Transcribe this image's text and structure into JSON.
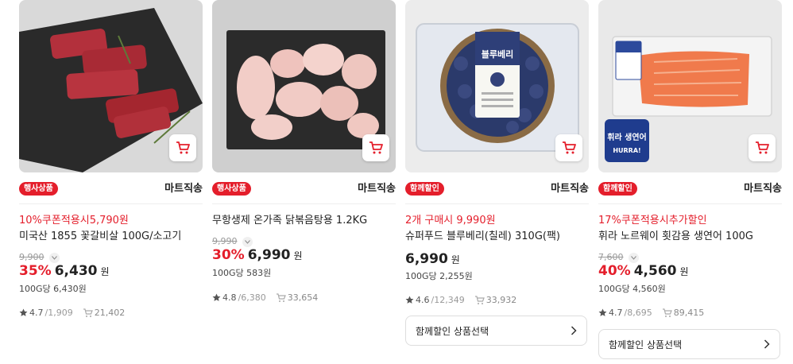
{
  "products": [
    {
      "badge": "행사상품",
      "seller": "마트직송",
      "promo": "10%쿠폰적용시5,790원",
      "name": "미국산 1855 꽃갈비살 100G/소고기",
      "original_price": "9,900",
      "discount": "35%",
      "price": "6,430",
      "won": "원",
      "unit_price": "100G당 6,430원",
      "rating": "4.7",
      "reviews": "/1,909",
      "cart_count": "21,402",
      "image": "beef-ribs-on-slate",
      "colors": {
        "bg": "#d8d8d8",
        "board": "#2a2a2a",
        "meat": "#b3303c"
      }
    },
    {
      "badge": "행사상품",
      "seller": "마트직송",
      "promo": "",
      "name": "무항생제 온가족 닭볶음탕용 1.2KG",
      "original_price": "9,990",
      "discount": "30%",
      "price": "6,990",
      "won": "원",
      "unit_price": "100G당 583원",
      "rating": "4.8",
      "reviews": "/6,380",
      "cart_count": "33,654",
      "image": "chicken-pieces-on-slate",
      "colors": {
        "bg": "#cfcfcf",
        "board": "#2b2b2b",
        "meat": "#f1c9c4"
      }
    },
    {
      "badge": "함께할인",
      "seller": "마트직송",
      "promo": "2개 구매시 9,990원",
      "name": "슈퍼푸드 블루베리(칠레) 310G(팩)",
      "original_price": "",
      "discount": "",
      "price": "6,990",
      "won": "원",
      "unit_price": "100G당 2,255원",
      "rating": "4.6",
      "reviews": "/12,349",
      "cart_count": "33,932",
      "combo_label": "함께할인 상품선택",
      "label_text": "블루베리",
      "image": "blueberry-pack",
      "colors": {
        "bg": "#ececec",
        "berry": "#2b3a6b"
      }
    },
    {
      "badge": "함께할인",
      "seller": "마트직송",
      "promo": "17%쿠폰적용시추가할인",
      "name": "휘라 노르웨이 횟감용 생연어 100G",
      "original_price": "7,600",
      "discount": "40%",
      "price": "4,560",
      "won": "원",
      "unit_price": "100G당 4,560원",
      "rating": "4.7",
      "reviews": "/8,695",
      "cart_count": "89,415",
      "combo_label": "함께할인 상품선택",
      "label_text": "휘라 생연어",
      "label_brand": "HURRA!",
      "image": "salmon-fillet-pack",
      "colors": {
        "bg": "#e9e9e9",
        "salmon": "#f07a4c"
      }
    }
  ],
  "icons": {
    "cart": "cart-icon",
    "star": "star-icon",
    "cart_small": "cart-count-icon",
    "chevron": "chevron-right-icon",
    "info": "chevron-down-icon"
  },
  "accent": "#e41e2b"
}
